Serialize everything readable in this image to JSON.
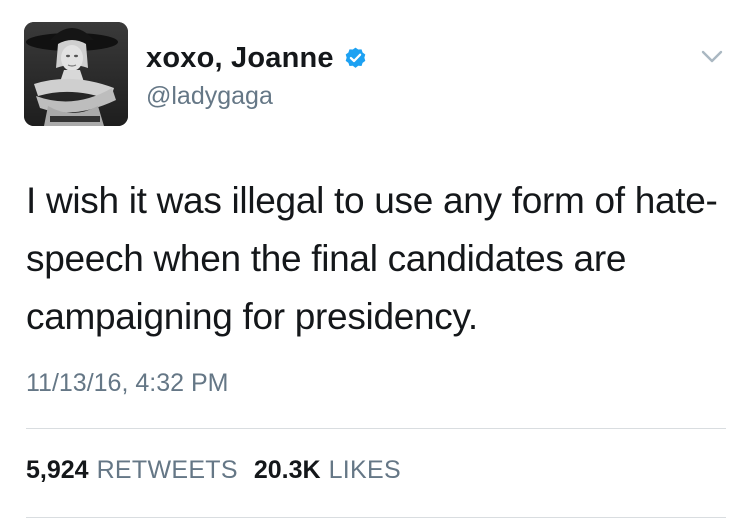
{
  "user": {
    "display_name": "xoxo, Joanne",
    "handle": "@ladygaga",
    "verified": true,
    "verified_color": "#1da1f2"
  },
  "tweet": {
    "text": "I wish it was illegal to use any form of hate-speech when the final candidates are campaigning for presidency.",
    "timestamp": "11/13/16, 4:32 PM"
  },
  "stats": {
    "retweets_count": "5,924",
    "retweets_label": "RETWEETS",
    "likes_count": "20.3K",
    "likes_label": "LIKES"
  },
  "icons": {
    "verified": "verified-badge-icon",
    "menu": "chevron-down-icon",
    "avatar": "profile-photo"
  },
  "colors": {
    "text_primary": "#14171a",
    "text_secondary": "#657786",
    "divider": "#d9dde0"
  }
}
